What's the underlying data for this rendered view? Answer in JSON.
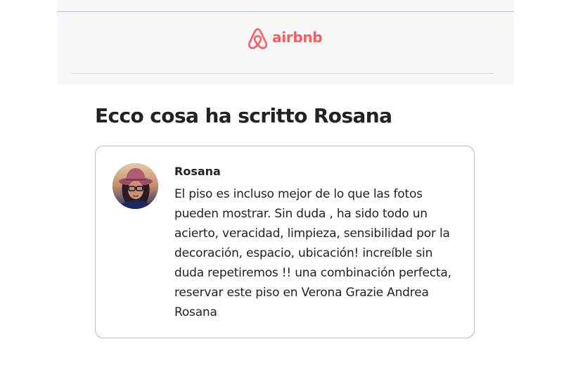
{
  "header": {
    "logo": {
      "text": "airbnb",
      "icon": "airbnb-belo-icon",
      "color": "#ff5a5f"
    }
  },
  "main": {
    "title": "Ecco cosa ha scritto Rosana",
    "review": {
      "avatar_icon": "user-avatar-photo",
      "reviewer_name": "Rosana",
      "text": "El piso es incluso mejor de lo que las fotos pueden mostrar. Sin duda , ha sido todo un acierto, veracidad, limpieza, sensibilidad por la decoración, espacio, ubicación! increíble sin duda repetiremos !! una combinación perfecta, reservar este piso en Verona Grazie Andrea Rosana"
    }
  }
}
